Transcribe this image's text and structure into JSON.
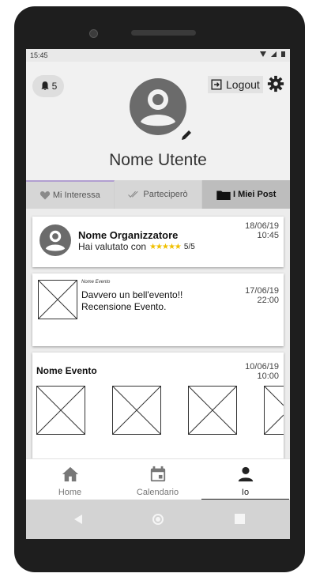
{
  "status": {
    "time": "15:45"
  },
  "header": {
    "notifications_count": "5",
    "logout_label": "Logout",
    "username": "Nome Utente"
  },
  "tabs": [
    {
      "label": "Mi Interessa"
    },
    {
      "label": "Parteciperò"
    },
    {
      "label": "I Miei Post"
    }
  ],
  "feed": {
    "organizer_card": {
      "name": "Nome Organizzatore",
      "rating_text": "Hai valutato con",
      "score": "5/5",
      "date": "18/06/19",
      "time": "10:45"
    },
    "review_card": {
      "event_name": "Nome Evento",
      "message": "Davvero un bell'evento!!",
      "subtitle": "Recensione Evento.",
      "date": "17/06/19",
      "time": "22:00"
    },
    "event_card": {
      "title": "Nome Evento",
      "date": "10/06/19",
      "time": "10:00"
    }
  },
  "nav": [
    {
      "label": "Home",
      "icon": "home-icon"
    },
    {
      "label": "Calendario",
      "icon": "calendar-icon"
    },
    {
      "label": "Io",
      "icon": "person-icon"
    }
  ],
  "colors": {
    "stars": "#f0c000",
    "tab_accent": "#b19fd0"
  }
}
